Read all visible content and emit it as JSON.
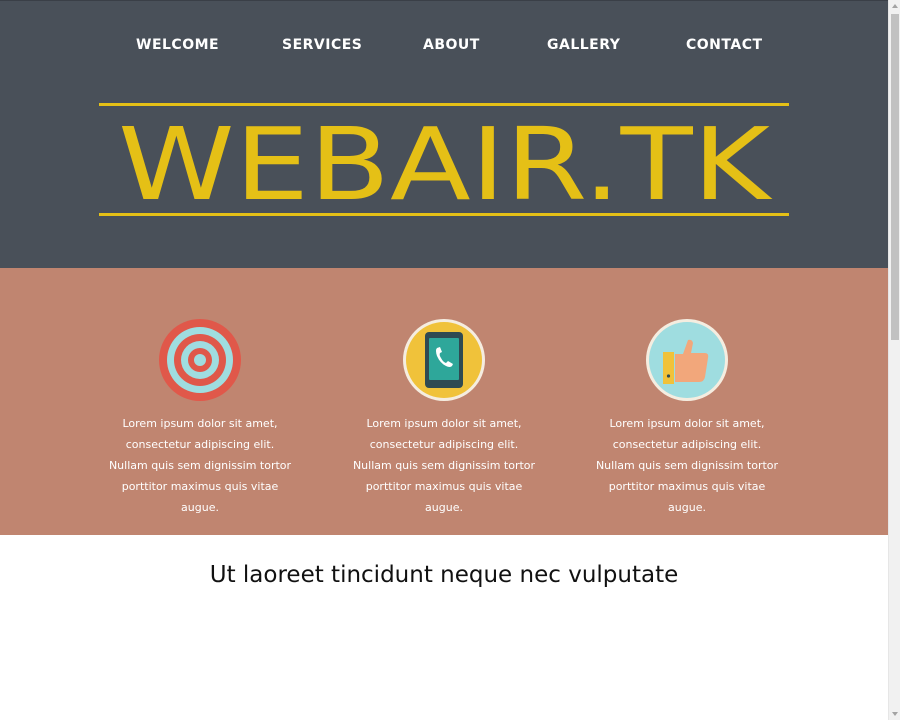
{
  "nav": {
    "items": [
      {
        "label": "WELCOME"
      },
      {
        "label": "SERVICES"
      },
      {
        "label": "ABOUT"
      },
      {
        "label": "GALLERY"
      },
      {
        "label": "CONTACT"
      }
    ]
  },
  "logo": {
    "text": "WEBAIR.TK",
    "color": "#e5c016"
  },
  "features": [
    {
      "icon": "target-icon",
      "text": "Lorem ipsum dolor sit amet, consectetur adipiscing elit. Nullam quis sem dignissim tortor porttitor maximus quis vitae augue."
    },
    {
      "icon": "phone-tablet-icon",
      "text": "Lorem ipsum dolor sit amet, consectetur adipiscing elit. Nullam quis sem dignissim tortor porttitor maximus quis vitae augue."
    },
    {
      "icon": "thumbs-up-icon",
      "text": "Lorem ipsum dolor sit amet, consectetur adipiscing elit. Nullam quis sem dignissim tortor porttitor maximus quis vitae augue."
    }
  ],
  "content": {
    "heading": "Ut laoreet tincidunt neque nec vulputate"
  },
  "colors": {
    "header_bg": "#495059",
    "accent": "#e5c016",
    "features_bg": "#c08570",
    "page_bg": "#ffffff"
  }
}
